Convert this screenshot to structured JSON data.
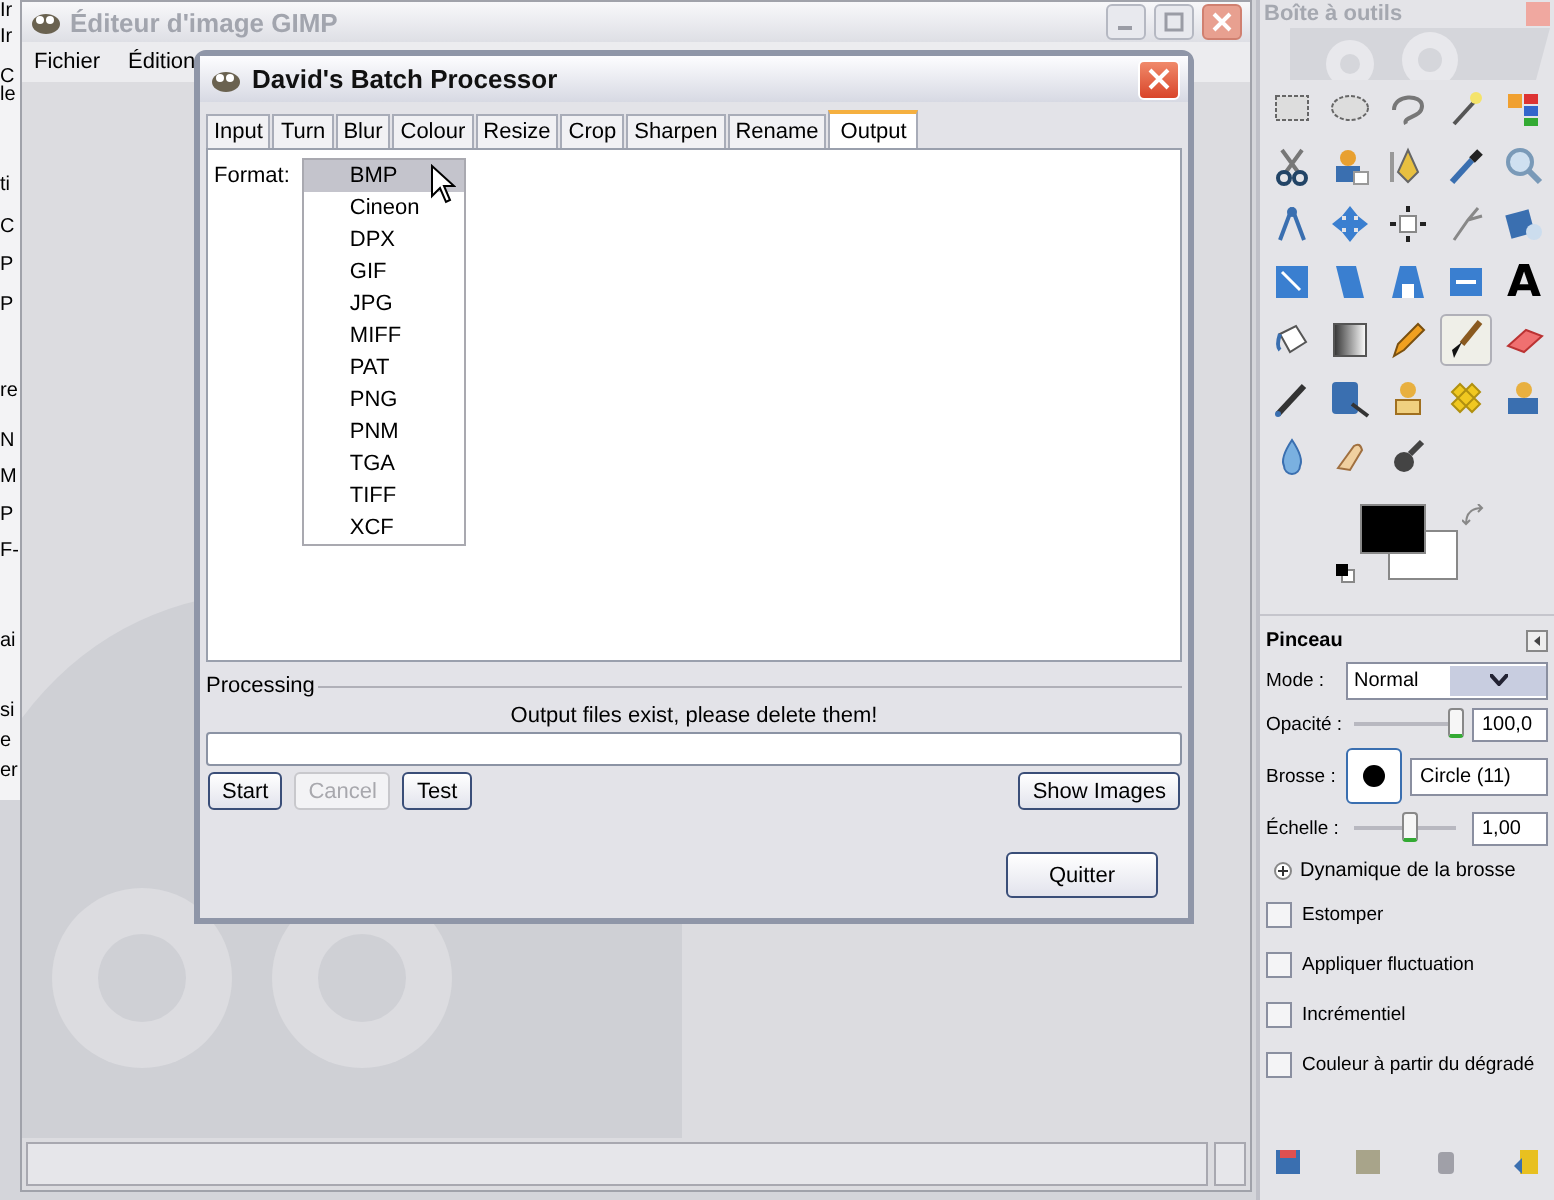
{
  "background_window": {
    "fragments": [
      "Ir",
      "Ir",
      "C",
      "le",
      "ti",
      "C",
      "P",
      "P",
      "re",
      "N",
      "M",
      "P",
      "F-",
      "ai",
      "si",
      "e",
      "er"
    ]
  },
  "main_window": {
    "title": "Éditeur d'image GIMP",
    "menu": [
      "Fichier",
      "Édition"
    ]
  },
  "dialog": {
    "title": "David's Batch Processor",
    "tabs": [
      {
        "label": "Input",
        "selected": false
      },
      {
        "label": "Turn",
        "selected": false
      },
      {
        "label": "Blur",
        "selected": false
      },
      {
        "label": "Colour",
        "selected": false
      },
      {
        "label": "Resize",
        "selected": false
      },
      {
        "label": "Crop",
        "selected": false
      },
      {
        "label": "Sharpen",
        "selected": false
      },
      {
        "label": "Rename",
        "selected": false
      },
      {
        "label": "Output",
        "selected": true
      }
    ],
    "format_label": "Format:",
    "formats": [
      {
        "label": "BMP",
        "selected": true
      },
      {
        "label": "Cineon",
        "selected": false
      },
      {
        "label": "DPX",
        "selected": false
      },
      {
        "label": "GIF",
        "selected": false
      },
      {
        "label": "JPG",
        "selected": false
      },
      {
        "label": "MIFF",
        "selected": false
      },
      {
        "label": "PAT",
        "selected": false
      },
      {
        "label": "PNG",
        "selected": false
      },
      {
        "label": "PNM",
        "selected": false
      },
      {
        "label": "TGA",
        "selected": false
      },
      {
        "label": "TIFF",
        "selected": false
      },
      {
        "label": "XCF",
        "selected": false
      }
    ],
    "processing": {
      "legend": "Processing",
      "message": "Output files exist, please delete them!",
      "level": 0,
      "buttons": [
        {
          "label": "Start",
          "disabled": false
        },
        {
          "label": "Cancel",
          "disabled": true
        },
        {
          "label": "Test",
          "disabled": false
        }
      ],
      "right_buttons": [
        {
          "label": "Show Images",
          "disabled": false
        }
      ]
    },
    "quit_button": "Quitter"
  },
  "toolbox": {
    "title": "Boîte à outils",
    "tools": [
      {
        "kind": "rect",
        "selected": false
      },
      {
        "kind": "ellipse",
        "selected": false
      },
      {
        "kind": "lasso",
        "selected": false
      },
      {
        "kind": "wand",
        "selected": false
      },
      {
        "kind": "colorsel",
        "selected": false
      },
      {
        "kind": "scissors",
        "selected": false
      },
      {
        "kind": "fgselect",
        "selected": false
      },
      {
        "kind": "pen",
        "selected": false
      },
      {
        "kind": "picker",
        "selected": false
      },
      {
        "kind": "zoom",
        "selected": false
      },
      {
        "kind": "compass",
        "selected": false
      },
      {
        "kind": "move",
        "selected": false
      },
      {
        "kind": "align",
        "selected": false
      },
      {
        "kind": "knife",
        "selected": false
      },
      {
        "kind": "rotate",
        "selected": false
      },
      {
        "kind": "scale",
        "selected": false
      },
      {
        "kind": "shear",
        "selected": false
      },
      {
        "kind": "perspective",
        "selected": false
      },
      {
        "kind": "flip",
        "selected": false
      },
      {
        "kind": "text",
        "glyph": "A",
        "selected": false
      },
      {
        "kind": "bucket",
        "selected": false
      },
      {
        "kind": "gradient",
        "selected": false
      },
      {
        "kind": "pencil",
        "selected": false
      },
      {
        "kind": "brush",
        "selected": true
      },
      {
        "kind": "eraser",
        "selected": false
      },
      {
        "kind": "airbrush",
        "selected": false
      },
      {
        "kind": "ink",
        "selected": false
      },
      {
        "kind": "stamp",
        "selected": false
      },
      {
        "kind": "heal",
        "selected": false
      },
      {
        "kind": "stamp2",
        "selected": false
      },
      {
        "kind": "drop",
        "selected": false
      },
      {
        "kind": "smudge",
        "selected": false
      },
      {
        "kind": "dodge",
        "selected": false
      }
    ],
    "options": {
      "title": "Pinceau",
      "mode": {
        "label": "Mode :",
        "value": "Normal"
      },
      "opacity": {
        "label": "Opacité :",
        "level": 1,
        "value": "100,0"
      },
      "brush": {
        "label": "Brosse :",
        "value": "Circle (11)"
      },
      "scale": {
        "label": "Échelle :",
        "level": 0.55,
        "value": "1,00"
      },
      "dynamics": {
        "label": "Dynamique de la brosse",
        "expanded": false
      },
      "checks": [
        {
          "label": "Estomper",
          "checked": false
        },
        {
          "label": "Appliquer fluctuation",
          "checked": false
        },
        {
          "label": "Incrémentiel",
          "checked": false
        },
        {
          "label": "Couleur à partir du dégradé",
          "checked": false
        }
      ]
    }
  }
}
